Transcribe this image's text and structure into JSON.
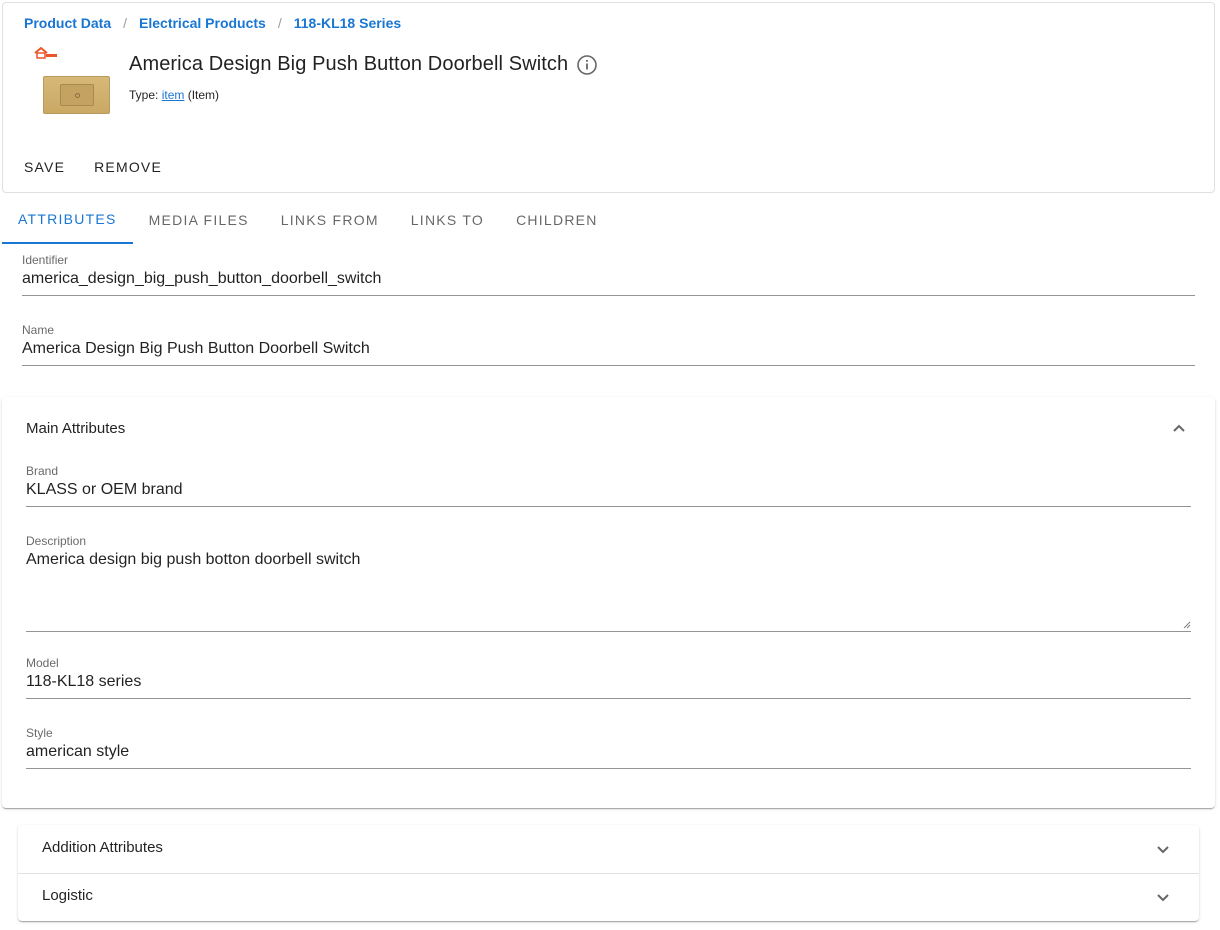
{
  "breadcrumb": [
    {
      "label": "Product Data"
    },
    {
      "label": "Electrical Products"
    },
    {
      "label": "118-KL18 Series"
    }
  ],
  "breadcrumb_separator": "/",
  "product": {
    "title": "America Design Big Push Button Doorbell Switch",
    "type_prefix": "Type:",
    "type_link": "item",
    "type_suffix": "(Item)"
  },
  "actions": {
    "save_label": "SAVE",
    "remove_label": "REMOVE"
  },
  "tabs": [
    {
      "label": "ATTRIBUTES",
      "active": true
    },
    {
      "label": "MEDIA FILES",
      "active": false
    },
    {
      "label": "LINKS FROM",
      "active": false
    },
    {
      "label": "LINKS TO",
      "active": false
    },
    {
      "label": "CHILDREN",
      "active": false
    }
  ],
  "fields": {
    "identifier": {
      "label": "Identifier",
      "value": "america_design_big_push_button_doorbell_switch"
    },
    "name": {
      "label": "Name",
      "value": "America Design Big Push Button Doorbell Switch"
    }
  },
  "main_attributes": {
    "title": "Main Attributes",
    "expanded": true,
    "brand": {
      "label": "Brand",
      "value": "KLASS or OEM brand"
    },
    "description": {
      "label": "Description",
      "value": "America design big push botton doorbell switch"
    },
    "model": {
      "label": "Model",
      "value": "118-KL18 series"
    },
    "style": {
      "label": "Style",
      "value": "american style"
    }
  },
  "collapsed_sections": [
    {
      "title": "Addition Attributes",
      "expanded": false
    },
    {
      "title": "Logistic",
      "expanded": false
    }
  ],
  "colors": {
    "accent": "#1976d2",
    "product_plate": "#d7b877",
    "logo": "#e8562a"
  },
  "icons": {
    "info": "info-circle-icon",
    "expand_less": "chevron-up-icon",
    "expand_more": "chevron-down-icon"
  }
}
